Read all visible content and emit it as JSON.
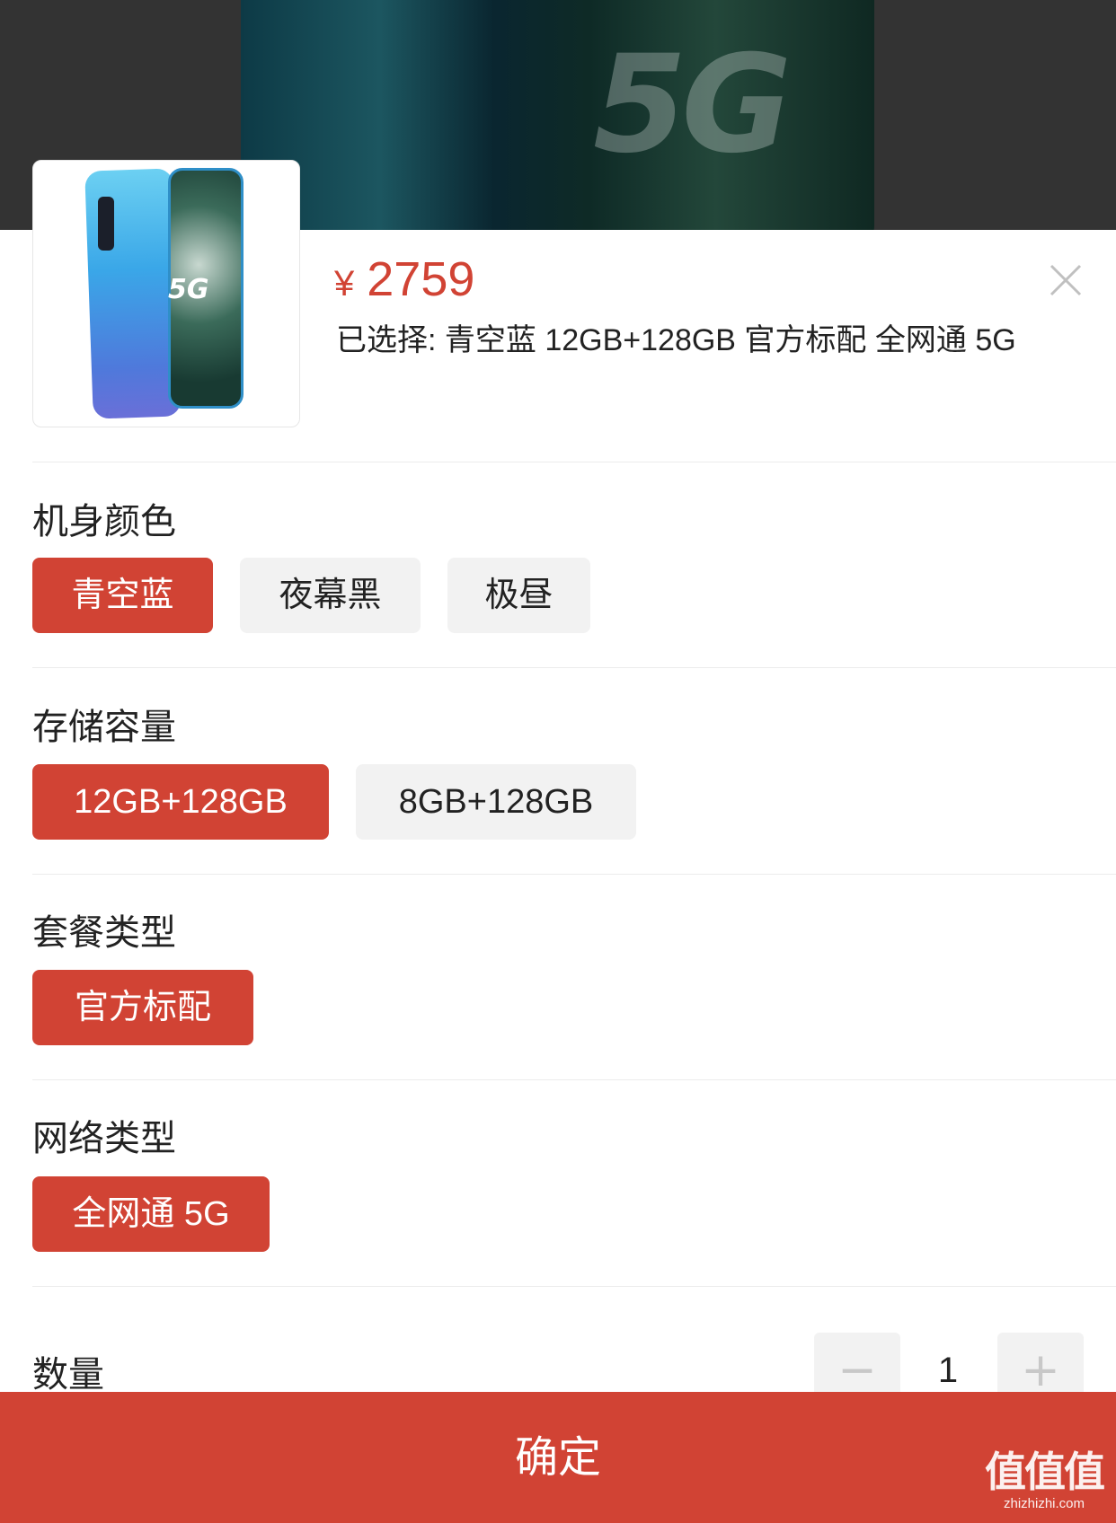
{
  "product": {
    "price_symbol": "¥",
    "price": "2759",
    "selected_text": "已选择: 青空蓝 12GB+128GB 官方标配 全网通 5G",
    "thumb_badge": "5G",
    "backdrop_badge": "5G"
  },
  "sections": {
    "color": {
      "title": "机身颜色",
      "options": [
        "青空蓝",
        "夜幕黑",
        "极昼"
      ],
      "selected": "青空蓝"
    },
    "storage": {
      "title": "存储容量",
      "options": [
        "12GB+128GB",
        "8GB+128GB"
      ],
      "selected": "12GB+128GB"
    },
    "package": {
      "title": "套餐类型",
      "options": [
        "官方标配"
      ],
      "selected": "官方标配"
    },
    "network": {
      "title": "网络类型",
      "options": [
        "全网通 5G"
      ],
      "selected": "全网通 5G"
    }
  },
  "quantity": {
    "label": "数量",
    "value": "1",
    "minus": "−",
    "plus": "+"
  },
  "confirm_label": "确定",
  "watermark": {
    "main": "值值值",
    "sub": "zhizhizhi.com"
  },
  "colors": {
    "accent": "#d14334",
    "chip_inactive": "#f2f2f2",
    "text": "#222222"
  }
}
